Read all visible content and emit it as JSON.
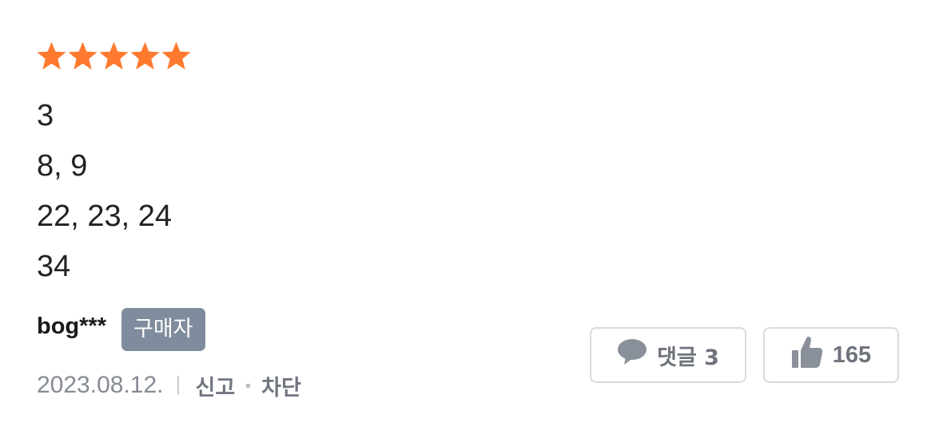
{
  "review": {
    "rating": 5,
    "rating_max": 5,
    "star_color": "#ff7a2f",
    "content_lines": [
      "3",
      "8, 9",
      "22, 23, 24",
      "34"
    ],
    "username": "bog***",
    "buyer_badge": "구매자",
    "date": "2023.08.12.",
    "report_label": "신고",
    "block_label": "차단"
  },
  "actions": {
    "comment_label": "댓글 3",
    "comment_icon": "speech-bubble-icon",
    "like_count": "165",
    "like_icon": "thumbs-up-icon"
  }
}
